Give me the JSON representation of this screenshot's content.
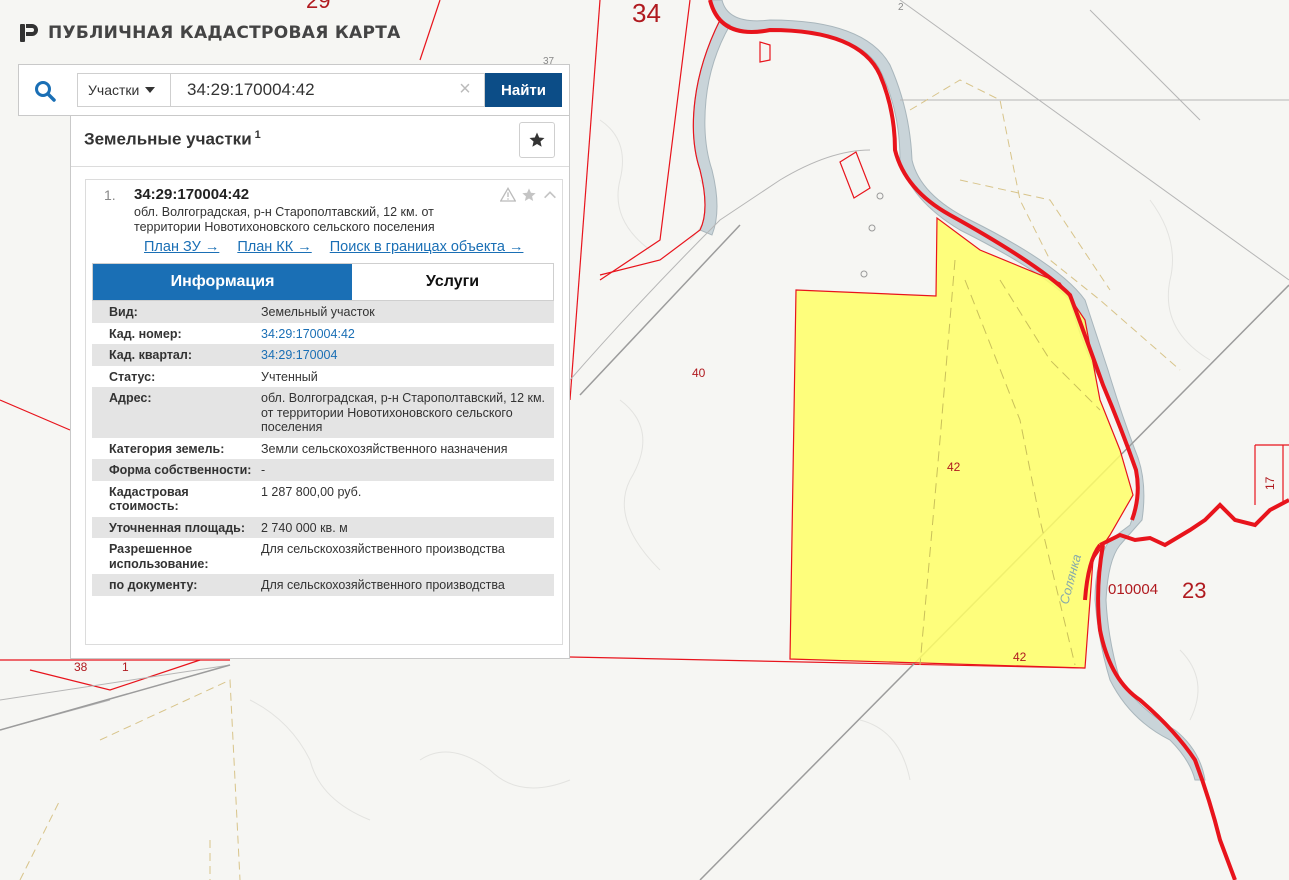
{
  "header": {
    "title": "ПУБЛИЧНАЯ КАДАСТРОВАЯ КАРТА"
  },
  "search": {
    "type_label": "Участки",
    "value": "34:29:170004:42",
    "find_label": "Найти",
    "clear_symbol": "×"
  },
  "results": {
    "title": "Земельные участки",
    "count": "1",
    "item": {
      "index": "1.",
      "number": "34:29:170004:42",
      "address": "обл. Волгоградская, р-н Старополтавский, 12 км. от территории Новотихоновского сельского поселения",
      "links": [
        "План ЗУ →",
        "План КК →",
        "Поиск в границах объекта →"
      ],
      "tabs": {
        "info": "Информация",
        "services": "Услуги"
      },
      "rows": [
        {
          "label": "Вид:",
          "value": "Земельный участок"
        },
        {
          "label": "Кад. номер:",
          "value": "34:29:170004:42"
        },
        {
          "label": "Кад. квартал:",
          "value": "34:29:170004"
        },
        {
          "label": "Статус:",
          "value": "Учтенный"
        },
        {
          "label": "Адрес:",
          "value": "обл. Волгоградская, р-н Старополтавский, 12 км. от территории Новотихоновского сельского поселения"
        },
        {
          "label": "Категория земель:",
          "value": "Земли сельскохозяйственного назначения"
        },
        {
          "label": "Форма собственности:",
          "value": "-"
        },
        {
          "label": "Кадастровая стоимость:",
          "value": "1 287 800,00 руб."
        },
        {
          "label": "Уточненная площадь:",
          "value": "2 740 000 кв. м"
        },
        {
          "label": "Разрешенное использование:",
          "value": "Для сельскохозяйственного производства"
        },
        {
          "label": "по документу:",
          "value": "Для сельскохозяйственного производства"
        }
      ]
    }
  },
  "map": {
    "labels": {
      "n34": "34",
      "n29": "29",
      "n37": "37",
      "n40": "40",
      "n42a": "42",
      "n42b": "42",
      "n38": "38",
      "n1": "1",
      "n17": "17",
      "code": "010004",
      "n23": "23",
      "river": "Солянка",
      "n2": "2"
    }
  },
  "colors": {
    "accent": "#0c4d87",
    "tab_active": "#1a6fb5",
    "parcel_fill": "#ffff66",
    "boundary_red": "#e8141c"
  }
}
